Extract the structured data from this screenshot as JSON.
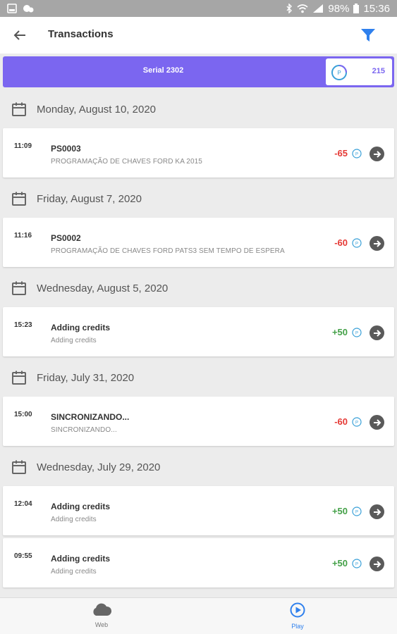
{
  "status_bar": {
    "battery": "98%",
    "time": "15:36"
  },
  "header": {
    "title": "Transactions"
  },
  "serial": {
    "label": "Serial 2302",
    "credits": "215"
  },
  "groups": [
    {
      "date": "Monday, August 10, 2020",
      "items": [
        {
          "time": "11:09",
          "title": "PS0003",
          "subtitle": "PROGRAMAÇÃO DE CHAVES FORD KA 2015",
          "amount": "-65"
        }
      ]
    },
    {
      "date": "Friday, August 7, 2020",
      "items": [
        {
          "time": "11:16",
          "title": "PS0002",
          "subtitle": "PROGRAMAÇÃO DE CHAVES FORD PATS3 SEM TEMPO DE ESPERA",
          "amount": "-60"
        }
      ]
    },
    {
      "date": "Wednesday, August 5, 2020",
      "items": [
        {
          "time": "15:23",
          "title": "Adding credits",
          "subtitle": "Adding credits",
          "amount": "+50"
        }
      ]
    },
    {
      "date": "Friday, July 31, 2020",
      "items": [
        {
          "time": "15:00",
          "title": "SINCRONIZANDO...",
          "subtitle": "SINCRONIZANDO...",
          "amount": "-60"
        }
      ]
    },
    {
      "date": "Wednesday, July 29, 2020",
      "items": [
        {
          "time": "12:04",
          "title": "Adding credits",
          "subtitle": "Adding credits",
          "amount": "+50"
        },
        {
          "time": "09:55",
          "title": "Adding credits",
          "subtitle": "Adding credits",
          "amount": "+50"
        }
      ]
    }
  ],
  "bottom_nav": {
    "web_label": "Web",
    "play_label": "Play"
  },
  "colors": {
    "accent": "#7b66f0",
    "negative": "#e53935",
    "positive": "#43a047",
    "active_nav": "#2f80ed"
  }
}
